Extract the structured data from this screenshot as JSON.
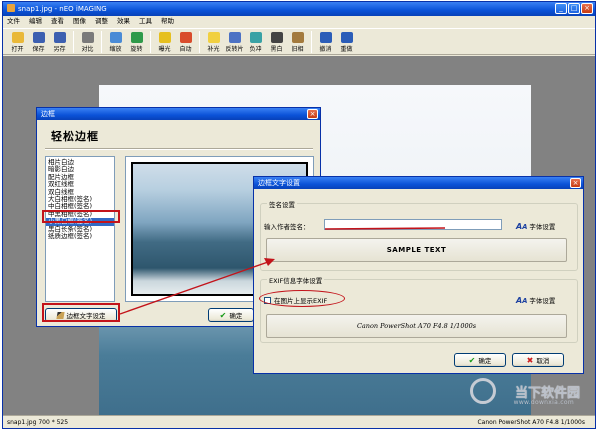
{
  "app": {
    "title": "snap1.jpg - nEO iMAGING",
    "menu": [
      "文件",
      "编辑",
      "查看",
      "图像",
      "调整",
      "效果",
      "工具",
      "帮助"
    ],
    "toolbar": [
      {
        "label": "打开",
        "icon": "open-folder-icon",
        "color": "#e9b838"
      },
      {
        "label": "保存",
        "icon": "save-disk-icon",
        "color": "#3c5fb0"
      },
      {
        "label": "另存",
        "icon": "save-as-icon",
        "color": "#3c5fb0"
      },
      {
        "label": "对比",
        "icon": "compare-icon",
        "color": "#7a7a7a"
      },
      {
        "label": "缩放",
        "icon": "zoom-icon",
        "color": "#4a8bd6"
      },
      {
        "label": "旋转",
        "icon": "rotate-icon",
        "color": "#2f9a4a"
      },
      {
        "label": "曝光",
        "icon": "exposure-icon",
        "color": "#e6c020"
      },
      {
        "label": "自动",
        "icon": "auto-icon",
        "color": "#d94c2c"
      },
      {
        "label": "补光",
        "icon": "fill-light-icon",
        "color": "#f1d040"
      },
      {
        "label": "反转片",
        "icon": "reversal-film-icon",
        "color": "#4c72c4"
      },
      {
        "label": "负冲",
        "icon": "cross-process-icon",
        "color": "#3aa2a5"
      },
      {
        "label": "黑白",
        "icon": "black-white-icon",
        "color": "#444444"
      },
      {
        "label": "旧相",
        "icon": "old-photo-icon",
        "color": "#a37a3d"
      },
      {
        "label": "撤消",
        "icon": "undo-icon",
        "color": "#2b5db8"
      },
      {
        "label": "重做",
        "icon": "redo-icon",
        "color": "#2b5db8"
      }
    ],
    "status_left": "snap1.jpg 700 * 525",
    "status_right": "Canon PowerShot A70 F4.8 1/1000s"
  },
  "border_dialog": {
    "title": "边框",
    "header": "轻松边框",
    "styles": [
      "相片白边",
      "暗影白边",
      "配片边框",
      "双红线框",
      "双白线框",
      "大白相框(签名)",
      "中白相框(签名)",
      "中黑相框(签名)",
      "小黑白框(签名)",
      "黑白长条(签名)",
      "纸质边框(签名)"
    ],
    "selected_style_index": 8,
    "border_text_button": "边框文字设定",
    "ok_button": "确定"
  },
  "text_dialog": {
    "title": "边框文字设置",
    "signature_group": "签名设置",
    "author_label": "输入作者签名：",
    "author_value": "",
    "font_button_1": "字体设置",
    "sample_text": "SAMPLE TEXT",
    "exif_group": "EXIF信息字体设置",
    "exif_checkbox": "在图片上显示EXIF",
    "exif_checked": false,
    "font_button_2": "字体设置",
    "exif_preview": "Canon PowerShot A70 F4.8 1/1000s",
    "ok_button": "确定",
    "cancel_button": "取消"
  },
  "watermark": {
    "text": "当下软件园",
    "url": "www.downxia.com"
  },
  "annotation_color": "#c3131a"
}
